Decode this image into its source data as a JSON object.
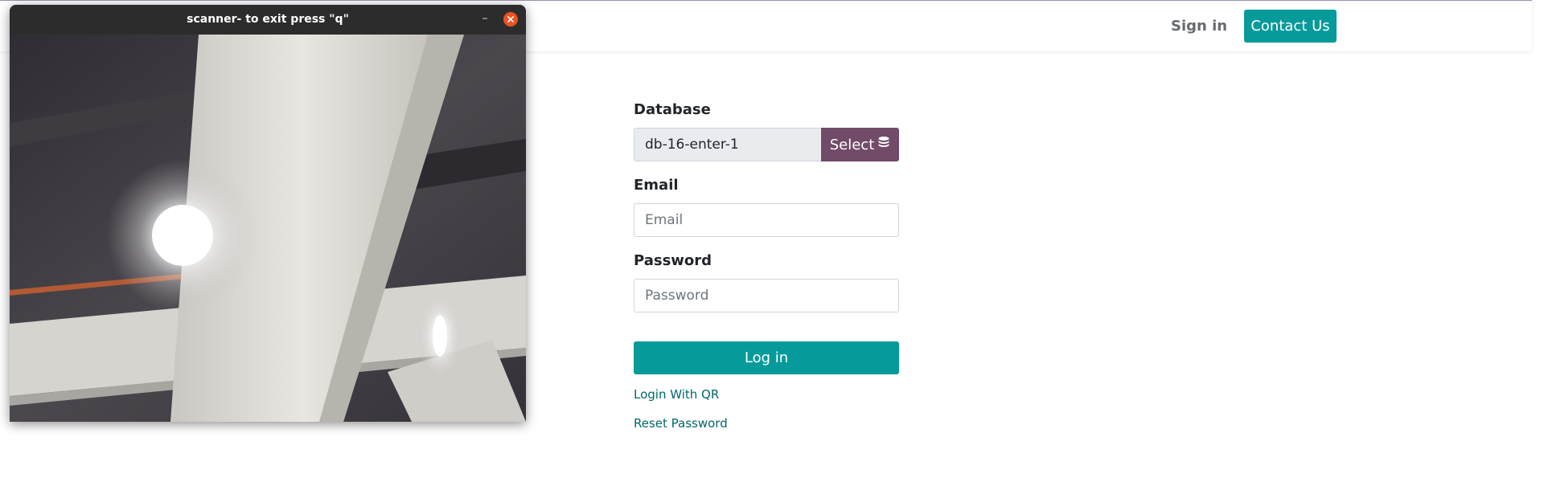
{
  "header": {
    "sign_in": "Sign in",
    "contact_us": "Contact Us"
  },
  "login_form": {
    "database_label": "Database",
    "database_value": "db-16-enter-1",
    "select_button": "Select",
    "email_label": "Email",
    "email_placeholder": "Email",
    "password_label": "Password",
    "password_placeholder": "Password",
    "login_button": "Log in",
    "login_with_qr": "Login With QR",
    "reset_password": "Reset Password"
  },
  "scanner_window": {
    "title": "scanner- to exit press \"q\"",
    "minimize_glyph": "–"
  },
  "icons": {
    "database": "database-icon",
    "minimize": "minimize-icon",
    "close": "close-icon"
  },
  "colors": {
    "primary": "#079a9b",
    "select_button": "#714b67",
    "link": "#01666b",
    "close_button": "#e95420"
  }
}
